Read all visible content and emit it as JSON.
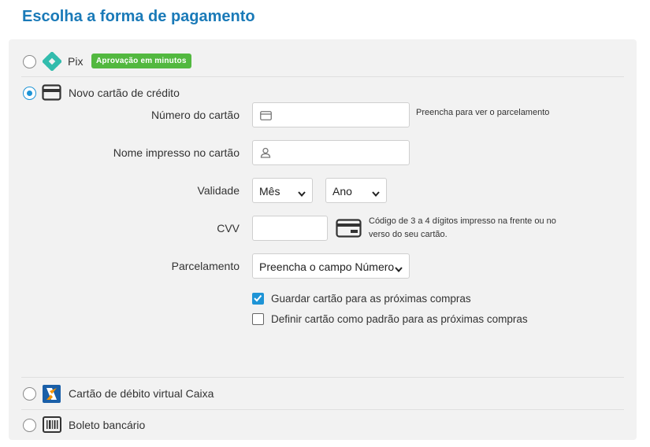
{
  "page": {
    "title": "Escolha a forma de pagamento"
  },
  "options": {
    "pix": {
      "label": "Pix",
      "badge": "Aprovação em minutos",
      "selected": false
    },
    "credit_card": {
      "label": "Novo cartão de crédito",
      "selected": true
    },
    "debit_caixa": {
      "label": "Cartão de débito virtual Caixa",
      "selected": false
    },
    "boleto": {
      "label": "Boleto bancário",
      "selected": false
    }
  },
  "form": {
    "card_number": {
      "label": "Número do cartão",
      "value": "",
      "hint": "Preencha para ver o parcelamento"
    },
    "card_name": {
      "label": "Nome impresso no cartão",
      "value": ""
    },
    "expiry": {
      "label": "Validade",
      "month": "Mês",
      "year": "Ano"
    },
    "cvv": {
      "label": "CVV",
      "value": "",
      "hint": "Código de 3 a 4 dígitos impresso na frente ou no verso do seu cartão."
    },
    "installments": {
      "label": "Parcelamento",
      "value": "Preencha o campo Número"
    },
    "save_card": {
      "label": "Guardar cartão para as próximas compras",
      "checked": true
    },
    "default_card": {
      "label": "Definir cartão como padrão para as próximas compras",
      "checked": false
    }
  },
  "colors": {
    "accent": "#1e94d6",
    "title": "#1a7ab8",
    "badge": "#52b83f",
    "pix": "#32bcad",
    "caixa": "#1a5fa8",
    "caixa_orange": "#f39200"
  }
}
